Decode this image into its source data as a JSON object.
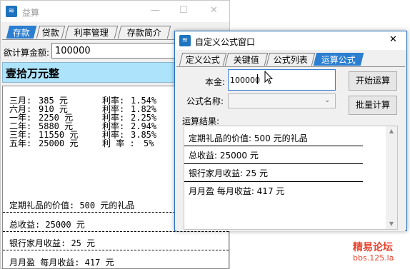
{
  "main_window": {
    "title": "益算",
    "controls": {
      "minimize": "—",
      "maximize": "☐",
      "close": "✕"
    },
    "tabs": [
      {
        "label": "存款",
        "active": true
      },
      {
        "label": "贷款"
      },
      {
        "label": "利率管理"
      },
      {
        "label": "存款简介"
      }
    ],
    "deposit_label": "欲计算金额:",
    "deposit_value": "100000",
    "amount_in_words": "壹拾万元整",
    "rates": [
      {
        "term": "三月:",
        "amount": "385  元",
        "rate_label": "利率:",
        "rate": "1.54%"
      },
      {
        "term": "六月:",
        "amount": "910  元",
        "rate_label": "利率:",
        "rate": "1.82%"
      },
      {
        "term": "一年:",
        "amount": "2250  元",
        "rate_label": "利率:",
        "rate": "2.25%"
      },
      {
        "term": "二年:",
        "amount": "5880  元",
        "rate_label": "利率:",
        "rate": "2.94%"
      },
      {
        "term": "三年:",
        "amount": "11550 元",
        "rate_label": "利率:",
        "rate": "3.85%"
      },
      {
        "term": "五年:",
        "amount": "25000 元",
        "rate_label": "利 率 :",
        "rate": "5%"
      }
    ],
    "lines": [
      "定期礼品的价值: 500 元的礼品",
      "总收益: 25000 元",
      "银行家月收益: 25 元",
      "月月盈  每月收益: 417 元"
    ]
  },
  "dialog": {
    "title": "自定义公式窗口",
    "close": "✕",
    "tabs": [
      {
        "label": "定义公式"
      },
      {
        "label": "关键值"
      },
      {
        "label": "公式列表"
      },
      {
        "label": "运算公式",
        "active": true
      }
    ],
    "principal_label": "本金:",
    "principal_value": "100000",
    "formula_label": "公式名称:",
    "formula_value": "",
    "start_button": "开始运算",
    "batch_button": "批量计算",
    "result_label": "运算结果:",
    "results": [
      "定期礼品的价值: 500 元的礼品",
      "总收益: 25000 元",
      "银行家月收益: 25 元",
      "月月盈  每月收益: 417 元"
    ]
  },
  "watermark": {
    "line1": "精易论坛",
    "line2": "bbs.125.la"
  },
  "colors": {
    "active_tab": "#2c7fd0",
    "words_bar": "#aee4fb",
    "dialog_border": "#1f6fbf",
    "watermark": "#e8412c"
  }
}
